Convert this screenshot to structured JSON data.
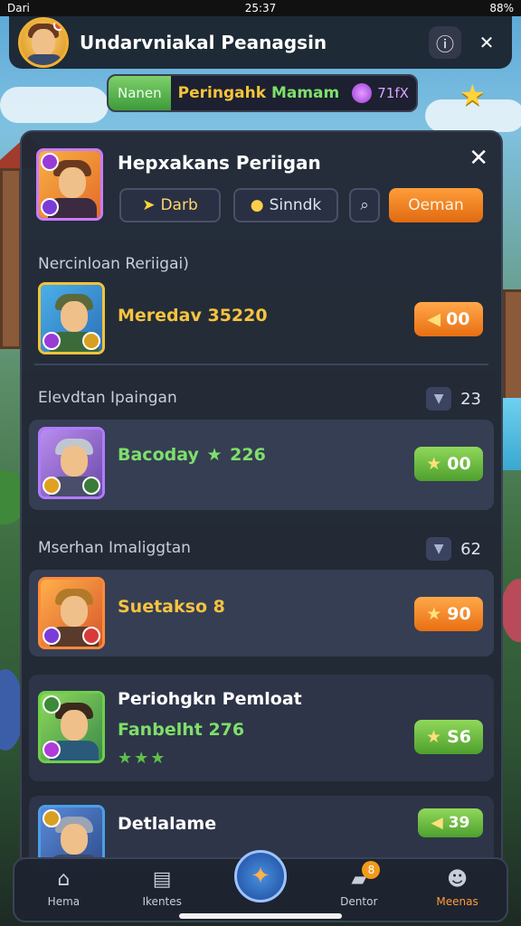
{
  "status_bar": {
    "carrier": "Dari",
    "time": "25:37",
    "battery": "88%"
  },
  "header": {
    "title": "Undarvniakal Peanagsin"
  },
  "promo": {
    "tab_label": "Nanen",
    "text_part1": "Peringahk",
    "text_part2": "Mamam",
    "value": "71fX"
  },
  "panel": {
    "title": "Hepxakans Periigan",
    "buttons": {
      "first": "Darb",
      "second": "Sinndk",
      "action": "Oeman"
    },
    "section1": {
      "label": "Nercinloan Reriigai)"
    },
    "row1": {
      "name": "Meredav 35220",
      "value": "00"
    },
    "section2": {
      "label": "Elevdtan Ipaingan",
      "count": "23"
    },
    "row2": {
      "name": "Bacoday",
      "score": "226",
      "value": "00"
    },
    "section3": {
      "label": "Mserhan Imaliggtan",
      "count": "62"
    },
    "row3": {
      "name": "Suetakso 8",
      "value": "90"
    },
    "row4": {
      "title": "Periohgkn Pemloat",
      "name": "Fanbelht",
      "score": "276",
      "value": "S6"
    },
    "row5": {
      "name": "Detlalame",
      "value": "39"
    }
  },
  "nav": {
    "items": [
      "Hema",
      "Ikentes",
      "",
      "Dentor",
      "Meenas"
    ],
    "badge": "8"
  },
  "colors": {
    "accent_orange": "#e86f12",
    "accent_green": "#4ea02e",
    "gold": "#f4c43a",
    "panel_bg": "#222836"
  },
  "icons": [
    "search-icon",
    "info-icon",
    "close-icon",
    "star-icon",
    "gem-icon",
    "home-icon",
    "book-icon",
    "compass-icon",
    "chat-icon",
    "profile-icon"
  ]
}
